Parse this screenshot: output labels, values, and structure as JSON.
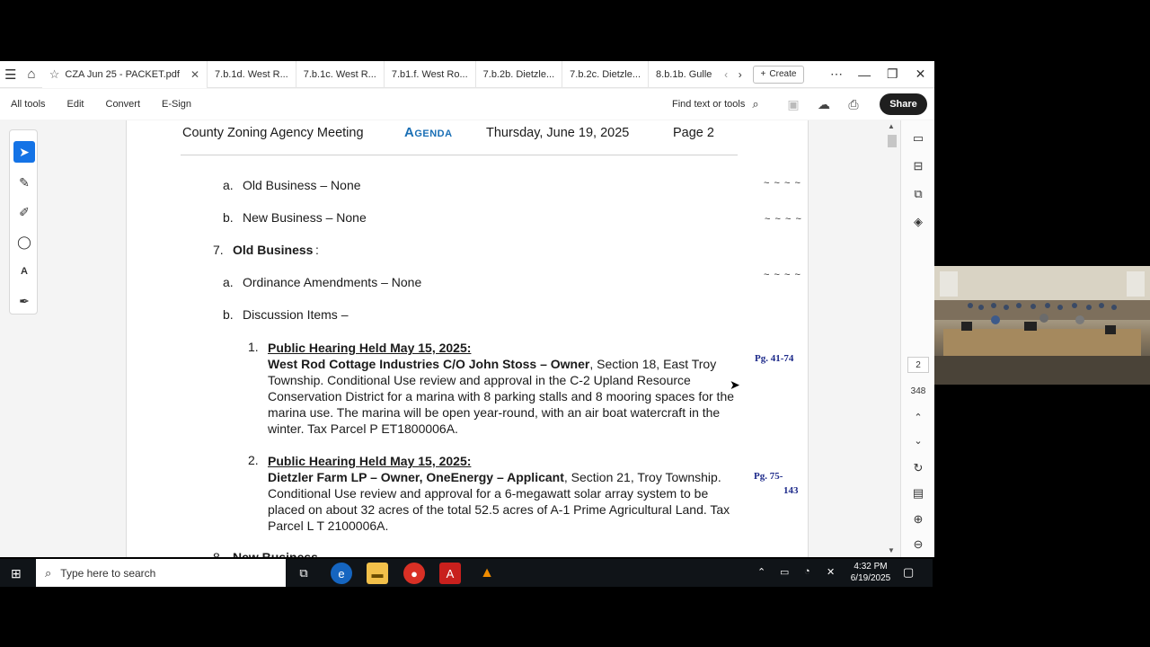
{
  "tabbar": {
    "active_tab": "CZA Jun 25 - PACKET.pdf",
    "tabs": [
      "7.b.1d. West R...",
      "7.b.1c. West R...",
      "7.b1.f. West Ro...",
      "7.b.2b. Dietzle...",
      "7.b.2c. Dietzle...",
      "8.b.1b. Gulle"
    ],
    "create_label": "Create"
  },
  "toolbar": {
    "items": [
      "All tools",
      "Edit",
      "Convert",
      "E-Sign"
    ],
    "find_label": "Find text or tools",
    "share_label": "Share"
  },
  "doc": {
    "header_title": "County Zoning Agency Meeting",
    "header_agenda": "Agenda",
    "header_date": "Thursday, June 19, 2025",
    "header_page": "Page 2",
    "item_a_old": "a.",
    "item_a_old_text": "Old Business – None",
    "item_b_new": "b.",
    "item_b_new_text": "New Business – None",
    "sec7_num": "7.",
    "sec7_title": "Old Business",
    "sec7_colon": ":",
    "item_a_ord": "a.",
    "item_a_ord_text": "Ordinance Amendments – None",
    "item_b_disc": "b.",
    "item_b_disc_text": "Discussion Items –",
    "dashes": "~ ~ ~ ~",
    "item1_num": "1.",
    "item1_hearing": "Public Hearing Held May 15, 2025:",
    "item1_owner": "West Rod Cottage Industries C/O John Stoss – Owner",
    "item1_body": ", Section 18, East Troy Township. Conditional Use review and approval in the C-2 Upland Resource Conservation District for a marina with 8 parking stalls and 8 mooring spaces for the marina use. The marina will be open year-round, with an air boat watercraft in the winter. Tax Parcel P ET1800006A.",
    "item1_pages": "Pg. 41-74",
    "item2_num": "2.",
    "item2_hearing": "Public Hearing Held May 15, 2025:",
    "item2_owner": "Dietzler Farm LP – Owner, OneEnergy – Applicant",
    "item2_body": ", Section 21, Troy Township. Conditional Use review and approval for a 6-megawatt solar array system to be placed on about 32 acres of the total 52.5 acres of A-1 Prime Agricultural Land. Tax Parcel L T 2100006A.",
    "item2_pages_a": "Pg. 75-",
    "item2_pages_b": "143",
    "sec8_num": "8.",
    "sec8_title": "New Business"
  },
  "rightpanel": {
    "current_page": "2",
    "total_pages": "348"
  },
  "taskbar": {
    "search_placeholder": "Type here to search",
    "time": "4:32 PM",
    "date": "6/19/2025"
  },
  "colors": {
    "agenda_blue": "#1a6fb5",
    "handwritten_blue": "#1d2a8a",
    "accent": "#1473e6"
  }
}
